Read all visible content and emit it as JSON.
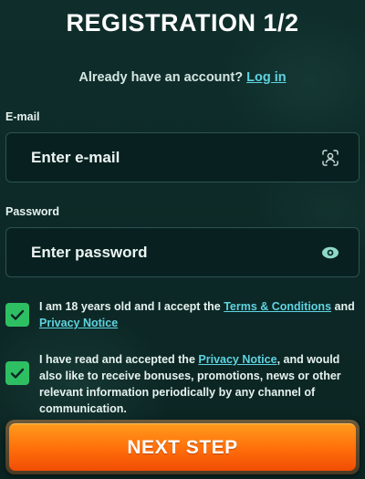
{
  "header": {
    "title": "REGISTRATION 1/2"
  },
  "login_prompt": {
    "text": "Already have an account?",
    "link": "Log in"
  },
  "email": {
    "label": "E-mail",
    "placeholder": "Enter e-mail",
    "icon": "face-scan-icon"
  },
  "password": {
    "label": "Password",
    "placeholder": "Enter password",
    "icon": "eye-icon"
  },
  "consent_terms": {
    "checked": true,
    "text_before": "I am 18 years old and I accept the",
    "terms_link": "Terms & Conditions",
    "text_and": "and",
    "privacy_link": "Privacy Notice"
  },
  "consent_marketing": {
    "checked": true,
    "text_before": "I have read and accepted the",
    "privacy_link": "Privacy Notice",
    "text_after": ", and would also like to receive bonuses, promotions, news or other relevant information periodically by any channel of communication."
  },
  "next_button": {
    "label": "NEXT STEP"
  },
  "colors": {
    "background": "#0d2a28",
    "link": "#5fd3e0",
    "checkbox": "#2fbf63",
    "button_orange": "#ff6d0a"
  }
}
